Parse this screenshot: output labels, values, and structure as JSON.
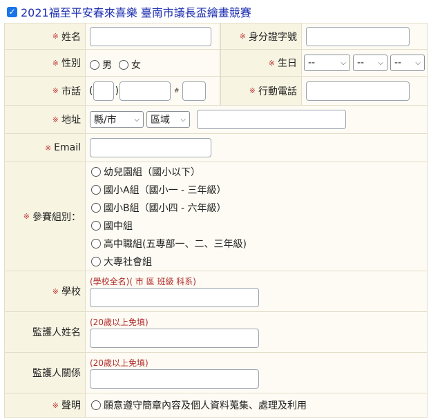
{
  "title": "2021福至平安春來喜樂 臺南市議長盃繪畫競賽",
  "required_mark": "※",
  "fields": {
    "name_label": "姓名",
    "id_label": "身分證字號",
    "gender_label": "性別",
    "gender_options": [
      "男",
      "女"
    ],
    "birthday_label": "生日",
    "birthday_selects": [
      "--",
      "--",
      "--"
    ],
    "phone_label": "市話",
    "phone_open_paren": "(",
    "phone_close_paren": ")",
    "phone_ext_mark": "#",
    "mobile_label": "行動電話",
    "address_label": "地址",
    "county_select": "縣/市",
    "district_select": "區域",
    "email_label": "Email",
    "group_label": "參賽組別：",
    "group_options": [
      "幼兒園組（國小以下）",
      "國小A組（國小一 - 三年級）",
      "國小B組（國小四 - 六年級）",
      "國中組",
      "高中職組(五專部一、二、三年級)",
      "大專社會組"
    ],
    "school_label": "學校",
    "school_note": "(學校全名)( 市 區 班級 科系)",
    "guardian_name_label": "監護人姓名",
    "guardian_name_note": "(20歲以上免填)",
    "guardian_rel_label": "監護人關係",
    "guardian_rel_note": "(20歲以上免填)",
    "declaration_label": "聲明",
    "declaration_option": "願意遵守簡章內容及個人資料蒐集、處理及利用"
  },
  "colors": {
    "label_bg": "#f7f4e2",
    "value_bg": "#fdfbf3",
    "title_blue": "#1d2fb0",
    "required_red": "#c03a3a",
    "note_red": "#b02b2b"
  }
}
